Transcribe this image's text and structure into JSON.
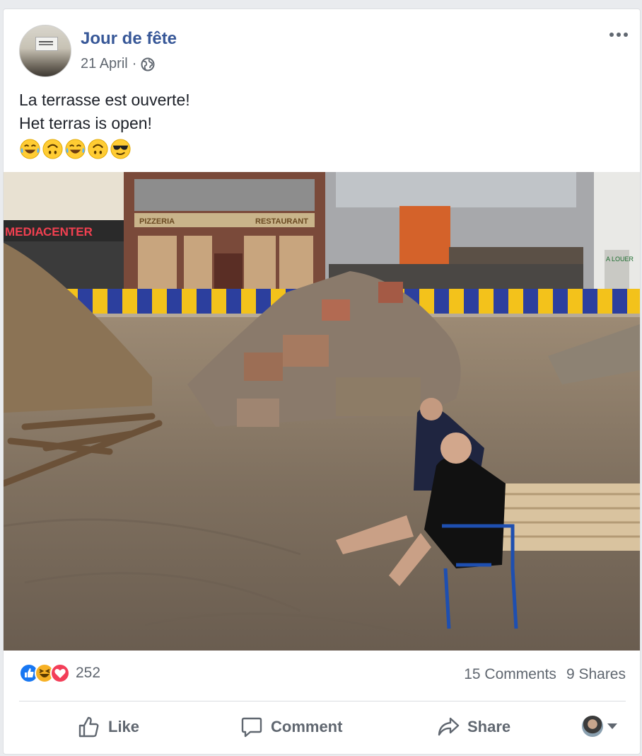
{
  "post": {
    "page_name": "Jour de fête",
    "date": "21 April",
    "separator": "·",
    "privacy_icon": "globe-icon",
    "more_icon": "more-horizontal-icon",
    "text_line1": "La terrasse est ouverte!",
    "text_line2": "Het terras is open!",
    "emojis": [
      "tears-of-joy",
      "upside-down-face",
      "tears-of-joy",
      "upside-down-face",
      "sunglasses-face"
    ],
    "photo_text": {
      "shop_sign_left": "MEDIA",
      "shop_sign_right": "CENTER",
      "storefront_sign_1": "PIZZERIA",
      "storefront_sign_3": "RESTAURANT",
      "for_rent_sign": "A LOUER"
    }
  },
  "stats": {
    "reactions": [
      "like",
      "haha",
      "love"
    ],
    "reaction_count": "252",
    "comments": "15 Comments",
    "shares": "9 Shares"
  },
  "actions": {
    "like": "Like",
    "comment": "Comment",
    "share": "Share"
  },
  "colors": {
    "link_blue": "#385898",
    "meta_grey": "#606770",
    "like_blue": "#1877f2",
    "love_red": "#f33e58",
    "haha_yellow": "#f7b125"
  }
}
